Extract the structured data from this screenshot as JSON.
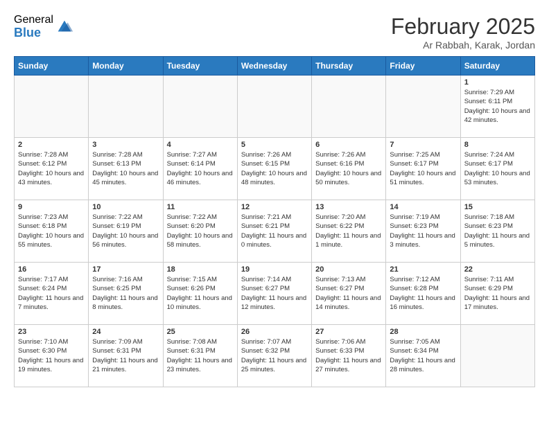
{
  "logo": {
    "general": "General",
    "blue": "Blue"
  },
  "header": {
    "month": "February 2025",
    "location": "Ar Rabbah, Karak, Jordan"
  },
  "days_of_week": [
    "Sunday",
    "Monday",
    "Tuesday",
    "Wednesday",
    "Thursday",
    "Friday",
    "Saturday"
  ],
  "weeks": [
    [
      {
        "day": "",
        "info": ""
      },
      {
        "day": "",
        "info": ""
      },
      {
        "day": "",
        "info": ""
      },
      {
        "day": "",
        "info": ""
      },
      {
        "day": "",
        "info": ""
      },
      {
        "day": "",
        "info": ""
      },
      {
        "day": "1",
        "info": "Sunrise: 7:29 AM\nSunset: 6:11 PM\nDaylight: 10 hours and 42 minutes."
      }
    ],
    [
      {
        "day": "2",
        "info": "Sunrise: 7:28 AM\nSunset: 6:12 PM\nDaylight: 10 hours and 43 minutes."
      },
      {
        "day": "3",
        "info": "Sunrise: 7:28 AM\nSunset: 6:13 PM\nDaylight: 10 hours and 45 minutes."
      },
      {
        "day": "4",
        "info": "Sunrise: 7:27 AM\nSunset: 6:14 PM\nDaylight: 10 hours and 46 minutes."
      },
      {
        "day": "5",
        "info": "Sunrise: 7:26 AM\nSunset: 6:15 PM\nDaylight: 10 hours and 48 minutes."
      },
      {
        "day": "6",
        "info": "Sunrise: 7:26 AM\nSunset: 6:16 PM\nDaylight: 10 hours and 50 minutes."
      },
      {
        "day": "7",
        "info": "Sunrise: 7:25 AM\nSunset: 6:17 PM\nDaylight: 10 hours and 51 minutes."
      },
      {
        "day": "8",
        "info": "Sunrise: 7:24 AM\nSunset: 6:17 PM\nDaylight: 10 hours and 53 minutes."
      }
    ],
    [
      {
        "day": "9",
        "info": "Sunrise: 7:23 AM\nSunset: 6:18 PM\nDaylight: 10 hours and 55 minutes."
      },
      {
        "day": "10",
        "info": "Sunrise: 7:22 AM\nSunset: 6:19 PM\nDaylight: 10 hours and 56 minutes."
      },
      {
        "day": "11",
        "info": "Sunrise: 7:22 AM\nSunset: 6:20 PM\nDaylight: 10 hours and 58 minutes."
      },
      {
        "day": "12",
        "info": "Sunrise: 7:21 AM\nSunset: 6:21 PM\nDaylight: 11 hours and 0 minutes."
      },
      {
        "day": "13",
        "info": "Sunrise: 7:20 AM\nSunset: 6:22 PM\nDaylight: 11 hours and 1 minute."
      },
      {
        "day": "14",
        "info": "Sunrise: 7:19 AM\nSunset: 6:23 PM\nDaylight: 11 hours and 3 minutes."
      },
      {
        "day": "15",
        "info": "Sunrise: 7:18 AM\nSunset: 6:23 PM\nDaylight: 11 hours and 5 minutes."
      }
    ],
    [
      {
        "day": "16",
        "info": "Sunrise: 7:17 AM\nSunset: 6:24 PM\nDaylight: 11 hours and 7 minutes."
      },
      {
        "day": "17",
        "info": "Sunrise: 7:16 AM\nSunset: 6:25 PM\nDaylight: 11 hours and 8 minutes."
      },
      {
        "day": "18",
        "info": "Sunrise: 7:15 AM\nSunset: 6:26 PM\nDaylight: 11 hours and 10 minutes."
      },
      {
        "day": "19",
        "info": "Sunrise: 7:14 AM\nSunset: 6:27 PM\nDaylight: 11 hours and 12 minutes."
      },
      {
        "day": "20",
        "info": "Sunrise: 7:13 AM\nSunset: 6:27 PM\nDaylight: 11 hours and 14 minutes."
      },
      {
        "day": "21",
        "info": "Sunrise: 7:12 AM\nSunset: 6:28 PM\nDaylight: 11 hours and 16 minutes."
      },
      {
        "day": "22",
        "info": "Sunrise: 7:11 AM\nSunset: 6:29 PM\nDaylight: 11 hours and 17 minutes."
      }
    ],
    [
      {
        "day": "23",
        "info": "Sunrise: 7:10 AM\nSunset: 6:30 PM\nDaylight: 11 hours and 19 minutes."
      },
      {
        "day": "24",
        "info": "Sunrise: 7:09 AM\nSunset: 6:31 PM\nDaylight: 11 hours and 21 minutes."
      },
      {
        "day": "25",
        "info": "Sunrise: 7:08 AM\nSunset: 6:31 PM\nDaylight: 11 hours and 23 minutes."
      },
      {
        "day": "26",
        "info": "Sunrise: 7:07 AM\nSunset: 6:32 PM\nDaylight: 11 hours and 25 minutes."
      },
      {
        "day": "27",
        "info": "Sunrise: 7:06 AM\nSunset: 6:33 PM\nDaylight: 11 hours and 27 minutes."
      },
      {
        "day": "28",
        "info": "Sunrise: 7:05 AM\nSunset: 6:34 PM\nDaylight: 11 hours and 28 minutes."
      },
      {
        "day": "",
        "info": ""
      }
    ]
  ]
}
